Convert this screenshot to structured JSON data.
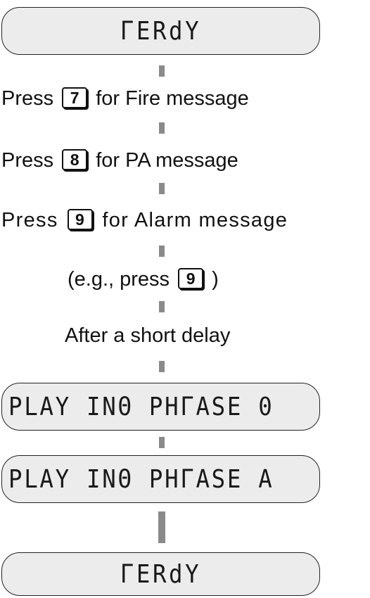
{
  "displays": {
    "ready_top": "ΓERdY",
    "playing_0": "PLAY INΘ PHΓASE 0",
    "playing_a": "PLAY INΘ PHΓASE A",
    "ready_bottom": "ΓERdY"
  },
  "steps": {
    "fire": {
      "prefix": "Press",
      "key": "7",
      "suffix": "for Fire message"
    },
    "pa": {
      "prefix": "Press",
      "key": "8",
      "suffix": "for PA message"
    },
    "alarm": {
      "prefix": "Press",
      "key": "9",
      "suffix": "for Alarm message"
    },
    "example": {
      "prefix": "(e.g., press",
      "key": "9",
      "suffix": ")"
    },
    "delay": "After a short delay"
  }
}
